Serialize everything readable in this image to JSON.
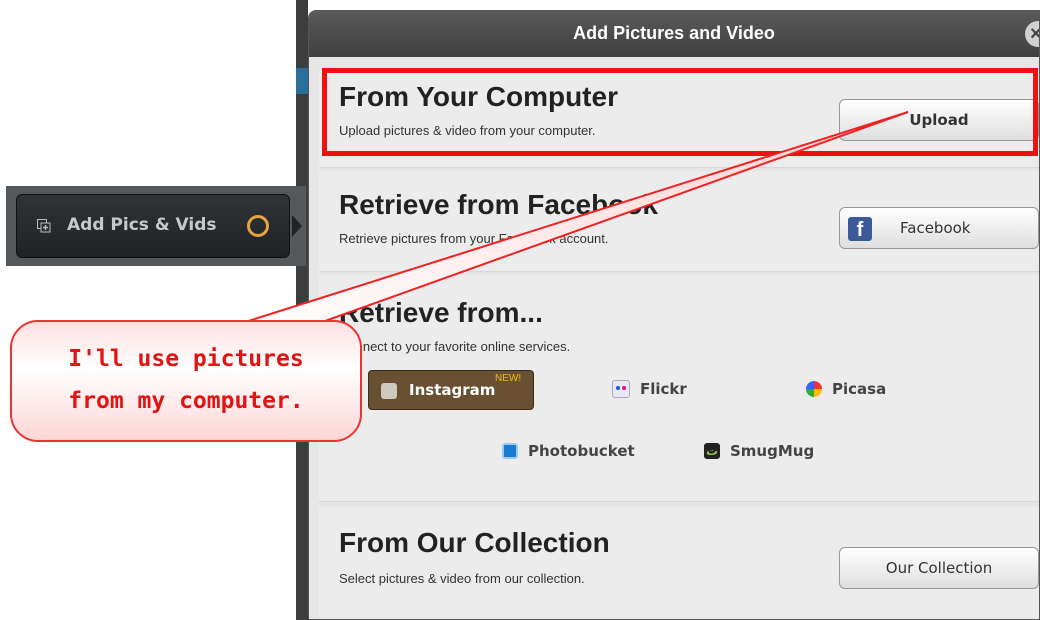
{
  "sidebar": {
    "button_label": "Add Pics & Vids"
  },
  "modal": {
    "title": "Add Pictures and Video",
    "close_glyph": "×",
    "sections": {
      "computer": {
        "title": "From Your Computer",
        "desc": "Upload pictures & video from your computer.",
        "button": "Upload"
      },
      "facebook": {
        "title": "Retrieve from Facebook",
        "desc": "Retrieve pictures from your Facebook account.",
        "button": "Facebook"
      },
      "services": {
        "title": "Retrieve from...",
        "desc": "Connect to your favorite online services.",
        "items": {
          "instagram": "Instagram",
          "instagram_badge": "NEW!",
          "flickr": "Flickr",
          "picasa": "Picasa",
          "photobucket": "Photobucket",
          "smugmug": "SmugMug"
        }
      },
      "collection": {
        "title": "From Our Collection",
        "desc": "Select pictures & video from our collection.",
        "button": "Our Collection"
      }
    }
  },
  "callout": {
    "line1": "I'll use pictures",
    "line2": "from my computer."
  },
  "colors": {
    "highlight": "#ee1111",
    "instagram_bg": "#6a5033",
    "facebook_blue": "#3b5998",
    "callout_text": "#e01414"
  },
  "icons": {
    "sidebar": "add-media-icon",
    "sidebar_status": "ring-icon",
    "facebook": "facebook-f-icon",
    "instagram": "camera-icon",
    "flickr": "flickr-dots-icon",
    "picasa": "picasa-icon",
    "photobucket": "photobucket-icon",
    "smugmug": "smugmug-icon",
    "close": "close-icon"
  }
}
